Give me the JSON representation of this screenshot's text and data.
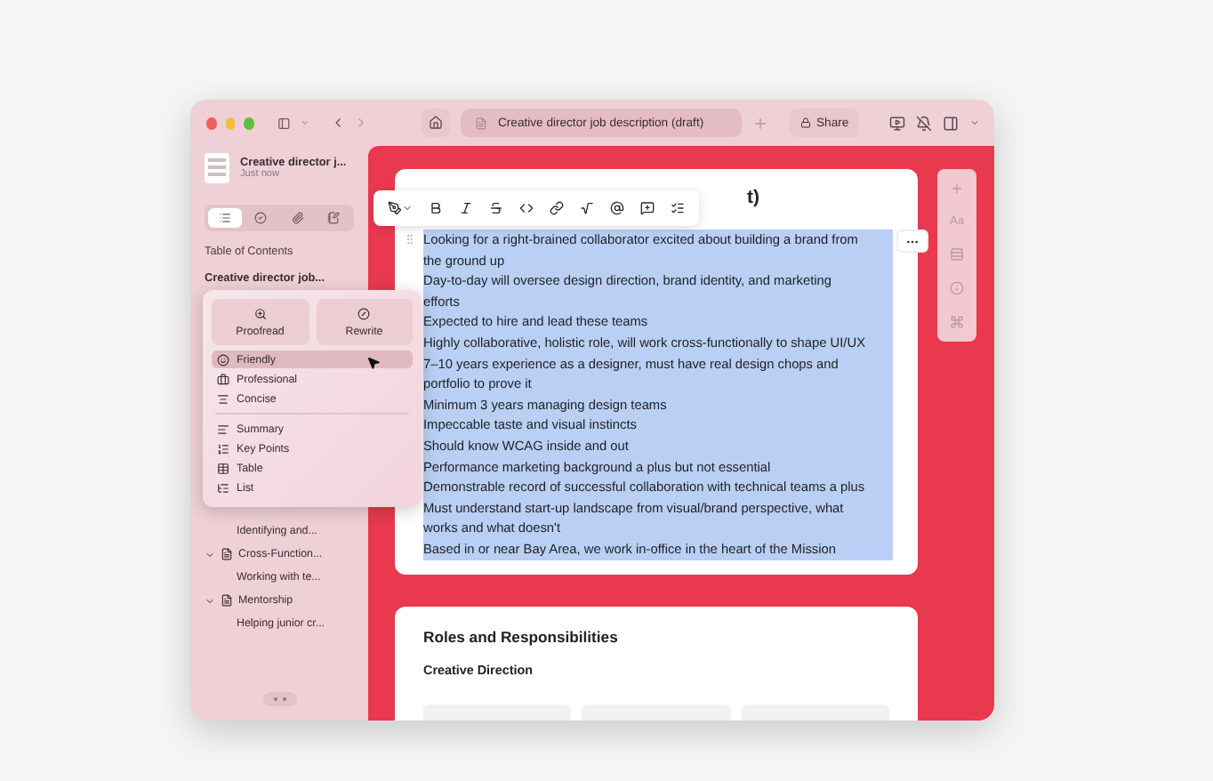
{
  "window": {
    "tab_title": "Creative director job description (draft)",
    "share": "Share"
  },
  "sidebar": {
    "doc_title": "Creative director j...",
    "doc_time": "Just now",
    "tabs": [
      {
        "kind": "list",
        "selected": true
      },
      {
        "kind": "check",
        "selected": false
      },
      {
        "kind": "clip",
        "selected": false
      },
      {
        "kind": "note",
        "selected": false
      }
    ],
    "toc_title": "Table of Contents",
    "items": [
      {
        "label": "Creative director job...",
        "children": [
          {
            "label": "Identifying and..."
          },
          {
            "label": "Cross-Function...",
            "expanded": true,
            "children": [
              {
                "label": "Working with te..."
              }
            ]
          },
          {
            "label": "Mentorship",
            "expanded": true,
            "children": [
              {
                "label": "Helping junior cr..."
              }
            ]
          }
        ]
      }
    ]
  },
  "ai_menu": {
    "actions": [
      {
        "label": "Proofread",
        "kind": "proofread"
      },
      {
        "label": "Rewrite",
        "kind": "rewrite"
      }
    ],
    "tones": [
      {
        "label": "Friendly",
        "kind": "friendly",
        "selected": true
      },
      {
        "label": "Professional",
        "kind": "professional",
        "selected": false
      },
      {
        "label": "Concise",
        "kind": "concise",
        "selected": false
      }
    ],
    "formats": [
      {
        "label": "Summary",
        "kind": "summary",
        "selected": false
      },
      {
        "label": "Key Points",
        "kind": "keypoints",
        "selected": false
      },
      {
        "label": "Table",
        "kind": "table",
        "selected": false
      },
      {
        "label": "List",
        "kind": "list",
        "selected": false
      }
    ]
  },
  "document": {
    "heading_visible": "t)",
    "lines": [
      "Looking for a right-brained collaborator excited about building a brand from the ground up",
      "Day-to-day will oversee design direction, brand identity, and marketing efforts",
      "Expected to hire and lead these teams",
      "Highly collaborative, holistic role, will work cross-functionally to shape UI/UX",
      "7–10 years experience as a designer, must have real design chops and portfolio to prove it",
      "Minimum 3 years managing design teams",
      "Impeccable taste and visual instincts",
      "Should know WCAG inside and out",
      "Performance marketing background a plus but not essential",
      "Demonstrable record of successful collaboration with technical teams a plus",
      "Must understand start-up landscape from visual/brand perspective, what works and what doesn't",
      "Based in or near Bay Area, we work in-office in the heart of the Mission"
    ],
    "selected": true,
    "section_title": "Roles and Responsibilities",
    "subsection_title": "Creative Direction"
  },
  "right_rail": {
    "font_label": "Aa"
  }
}
